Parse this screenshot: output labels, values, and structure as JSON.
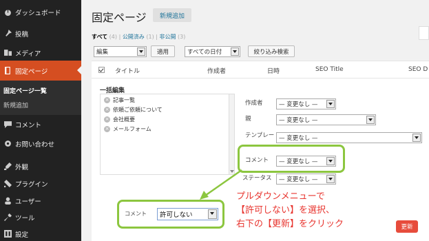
{
  "sidebar": {
    "items": [
      {
        "label": "ダッシュボード",
        "icon": "dashboard-icon"
      },
      {
        "label": "投稿",
        "icon": "pin-icon"
      },
      {
        "label": "メディア",
        "icon": "media-icon"
      },
      {
        "label": "固定ページ",
        "icon": "pages-icon"
      },
      {
        "label": "コメント",
        "icon": "comments-icon"
      },
      {
        "label": "お問い合わせ",
        "icon": "gear-icon"
      },
      {
        "label": "外観",
        "icon": "appearance-icon"
      },
      {
        "label": "プラグイン",
        "icon": "plugins-icon"
      },
      {
        "label": "ユーザー",
        "icon": "user-icon"
      },
      {
        "label": "ツール",
        "icon": "wrench-icon"
      },
      {
        "label": "設定",
        "icon": "settings-icon"
      }
    ],
    "submenu": [
      "固定ページ一覧",
      "新規追加"
    ]
  },
  "header": {
    "title": "固定ページ",
    "add_new": "新規追加"
  },
  "filters": {
    "all": "すべて",
    "all_count": "(4)",
    "published": "公開済み",
    "published_count": "(1)",
    "private": "非公開",
    "private_count": "(3)",
    "sep": "|"
  },
  "toolbar": {
    "bulk_action": "編集",
    "apply": "適用",
    "date_filter": "すべての日付",
    "filter_button": "絞り込み検索"
  },
  "table": {
    "columns": [
      "タイトル",
      "作成者",
      "日時",
      "SEO Title",
      "SEO D"
    ]
  },
  "bulk_edit": {
    "title": "一括編集",
    "pages": [
      "記事一覧",
      "依頼ご依頼について",
      "会社概要",
      "メールフォーム"
    ],
    "fields": [
      {
        "label": "作成者",
        "value": "— 変更なし —"
      },
      {
        "label": "親",
        "value": "— 変更なし —"
      },
      {
        "label": "テンプレート",
        "value": "— 変更なし —"
      },
      {
        "label": "コメント",
        "value": "— 変更なし —"
      },
      {
        "label": "ステータス",
        "value": "— 変更なし —"
      }
    ],
    "callout": {
      "label": "コメント",
      "value": "許可しない"
    },
    "note": [
      "プルダウンメニューで",
      "【許可しない】を選択、",
      "右下の【更新】をクリック"
    ],
    "update_button": "更新"
  },
  "colors": {
    "accent": "#d54e21",
    "highlight": "#8cc63f",
    "note": "#e8352f",
    "update": "#e74c3c",
    "link": "#21759b"
  }
}
